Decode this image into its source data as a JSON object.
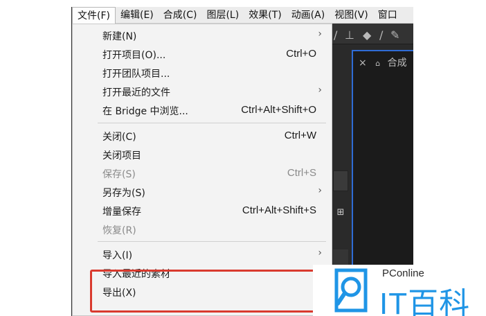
{
  "menubar": {
    "items": [
      {
        "label": "文件(F)"
      },
      {
        "label": "编辑(E)"
      },
      {
        "label": "合成(C)"
      },
      {
        "label": "图层(L)"
      },
      {
        "label": "效果(T)"
      },
      {
        "label": "动画(A)"
      },
      {
        "label": "视图(V)"
      },
      {
        "label": "窗口"
      }
    ]
  },
  "file_menu": {
    "items": [
      {
        "label": "新建(N)",
        "shortcut": "",
        "submenu": true,
        "enabled": true
      },
      {
        "label": "打开项目(O)...",
        "shortcut": "Ctrl+O",
        "submenu": false,
        "enabled": true
      },
      {
        "label": "打开团队项目...",
        "shortcut": "",
        "submenu": false,
        "enabled": true
      },
      {
        "label": "打开最近的文件",
        "shortcut": "",
        "submenu": true,
        "enabled": true
      },
      {
        "label": "在 Bridge 中浏览...",
        "shortcut": "Ctrl+Alt+Shift+O",
        "submenu": false,
        "enabled": true
      },
      {
        "label": "关闭(C)",
        "shortcut": "Ctrl+W",
        "submenu": false,
        "enabled": true
      },
      {
        "label": "关闭项目",
        "shortcut": "",
        "submenu": false,
        "enabled": true
      },
      {
        "label": "保存(S)",
        "shortcut": "Ctrl+S",
        "submenu": false,
        "enabled": false
      },
      {
        "label": "另存为(S)",
        "shortcut": "",
        "submenu": true,
        "enabled": true
      },
      {
        "label": "增量保存",
        "shortcut": "Ctrl+Alt+Shift+S",
        "submenu": false,
        "enabled": true
      },
      {
        "label": "恢复(R)",
        "shortcut": "",
        "submenu": false,
        "enabled": false
      },
      {
        "label": "导入(I)",
        "shortcut": "",
        "submenu": true,
        "enabled": true
      },
      {
        "label": "导入最近的素材",
        "shortcut": "",
        "submenu": false,
        "enabled": true
      },
      {
        "label": "导出(X)",
        "shortcut": "",
        "submenu": false,
        "enabled": true
      }
    ],
    "submenu_glyph": "›"
  },
  "panel": {
    "close_glyph": "×",
    "lock_glyph": "🔓",
    "tab_label": "合成"
  },
  "watermark": {
    "small": "PConline",
    "big": "IT百科",
    "color": "#1f95e6"
  },
  "highlight_color": "#d93a2e"
}
